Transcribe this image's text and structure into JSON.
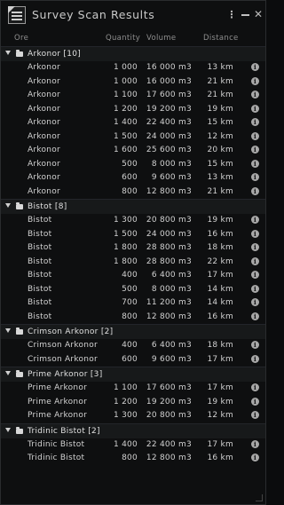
{
  "window": {
    "title": "Survey Scan Results"
  },
  "columns": {
    "ore": "Ore",
    "quantity": "Quantity",
    "volume": "Volume",
    "distance": "Distance"
  },
  "groups": [
    {
      "label": "Arkonor [10]",
      "rows": [
        {
          "ore": "Arkonor",
          "quantity": "1 000",
          "volume": "16 000 m3",
          "distance": "13 km"
        },
        {
          "ore": "Arkonor",
          "quantity": "1 000",
          "volume": "16 000 m3",
          "distance": "21 km"
        },
        {
          "ore": "Arkonor",
          "quantity": "1 100",
          "volume": "17 600 m3",
          "distance": "21 km"
        },
        {
          "ore": "Arkonor",
          "quantity": "1 200",
          "volume": "19 200 m3",
          "distance": "19 km"
        },
        {
          "ore": "Arkonor",
          "quantity": "1 400",
          "volume": "22 400 m3",
          "distance": "15 km"
        },
        {
          "ore": "Arkonor",
          "quantity": "1 500",
          "volume": "24 000 m3",
          "distance": "12 km"
        },
        {
          "ore": "Arkonor",
          "quantity": "1 600",
          "volume": "25 600 m3",
          "distance": "20 km"
        },
        {
          "ore": "Arkonor",
          "quantity": "500",
          "volume": "8 000 m3",
          "distance": "15 km"
        },
        {
          "ore": "Arkonor",
          "quantity": "600",
          "volume": "9 600 m3",
          "distance": "13 km"
        },
        {
          "ore": "Arkonor",
          "quantity": "800",
          "volume": "12 800 m3",
          "distance": "21 km"
        }
      ]
    },
    {
      "label": "Bistot [8]",
      "rows": [
        {
          "ore": "Bistot",
          "quantity": "1 300",
          "volume": "20 800 m3",
          "distance": "19 km"
        },
        {
          "ore": "Bistot",
          "quantity": "1 500",
          "volume": "24 000 m3",
          "distance": "16 km"
        },
        {
          "ore": "Bistot",
          "quantity": "1 800",
          "volume": "28 800 m3",
          "distance": "18 km"
        },
        {
          "ore": "Bistot",
          "quantity": "1 800",
          "volume": "28 800 m3",
          "distance": "22 km"
        },
        {
          "ore": "Bistot",
          "quantity": "400",
          "volume": "6 400 m3",
          "distance": "17 km"
        },
        {
          "ore": "Bistot",
          "quantity": "500",
          "volume": "8 000 m3",
          "distance": "14 km"
        },
        {
          "ore": "Bistot",
          "quantity": "700",
          "volume": "11 200 m3",
          "distance": "14 km"
        },
        {
          "ore": "Bistot",
          "quantity": "800",
          "volume": "12 800 m3",
          "distance": "16 km"
        }
      ]
    },
    {
      "label": "Crimson Arkonor [2]",
      "rows": [
        {
          "ore": "Crimson Arkonor",
          "quantity": "400",
          "volume": "6 400 m3",
          "distance": "18 km"
        },
        {
          "ore": "Crimson Arkonor",
          "quantity": "600",
          "volume": "9 600 m3",
          "distance": "17 km"
        }
      ]
    },
    {
      "label": "Prime Arkonor [3]",
      "rows": [
        {
          "ore": "Prime Arkonor",
          "quantity": "1 100",
          "volume": "17 600 m3",
          "distance": "17 km"
        },
        {
          "ore": "Prime Arkonor",
          "quantity": "1 200",
          "volume": "19 200 m3",
          "distance": "19 km"
        },
        {
          "ore": "Prime Arkonor",
          "quantity": "1 300",
          "volume": "20 800 m3",
          "distance": "12 km"
        }
      ]
    },
    {
      "label": "Tridinic Bistot [2]",
      "rows": [
        {
          "ore": "Tridinic Bistot",
          "quantity": "1 400",
          "volume": "22 400 m3",
          "distance": "17 km"
        },
        {
          "ore": "Tridinic Bistot",
          "quantity": "800",
          "volume": "12 800 m3",
          "distance": "16 km"
        }
      ]
    }
  ],
  "icons": {
    "app": "scan-results-icon",
    "menu": "kebab-menu-icon",
    "minimize": "minimize-icon",
    "close": "close-icon",
    "group": "folder-icon",
    "expand": "chevron-down-icon",
    "info": "info-icon"
  }
}
